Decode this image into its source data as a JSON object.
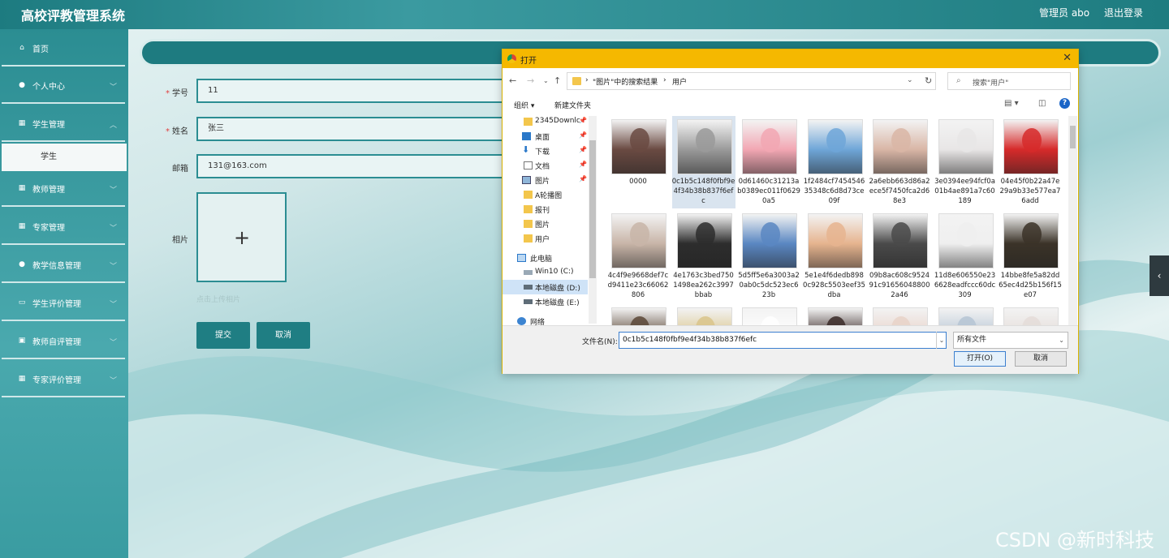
{
  "app": {
    "title": "高校评教管理系统",
    "user_label": "管理员 abo",
    "logout": "退出登录"
  },
  "sidebar": {
    "items": [
      {
        "label": "首页",
        "icon": "home-icon"
      },
      {
        "label": "个人中心",
        "icon": "user-icon"
      },
      {
        "label": "学生管理",
        "icon": "grid-icon"
      },
      {
        "label": "教师管理",
        "icon": "grid-icon"
      },
      {
        "label": "专家管理",
        "icon": "grid-icon"
      },
      {
        "label": "教学信息管理",
        "icon": "user-icon"
      },
      {
        "label": "学生评价管理",
        "icon": "id-card-icon"
      },
      {
        "label": "教师自评管理",
        "icon": "case-icon"
      },
      {
        "label": "专家评价管理",
        "icon": "grid-icon"
      }
    ],
    "sub_item": "学生"
  },
  "form": {
    "fields": [
      {
        "label": "学号",
        "required": "*",
        "value": "11"
      },
      {
        "label": "姓名",
        "required": "*",
        "value": "张三"
      },
      {
        "label": "邮箱",
        "required": "",
        "value": "131@163.com"
      }
    ],
    "photo_label": "相片",
    "upload_hint": "点击上传相片",
    "submit": "提交",
    "cancel": "取消"
  },
  "dialog": {
    "title": "打开",
    "breadcrumb": [
      "\"图片\"中的搜索结果",
      "用户"
    ],
    "search_placeholder": "搜索\"用户\"",
    "toolbar": {
      "organize": "组织 ▾",
      "new_folder": "新建文件夹"
    },
    "tree": [
      {
        "label": "2345Downlc",
        "pinned": true,
        "icon": "folder"
      },
      {
        "label": "桌面",
        "pinned": true,
        "icon": "desktop"
      },
      {
        "label": "下载",
        "pinned": true,
        "icon": "download"
      },
      {
        "label": "文档",
        "pinned": true,
        "icon": "document"
      },
      {
        "label": "图片",
        "pinned": true,
        "icon": "picture"
      },
      {
        "label": "A轮播图",
        "pinned": false,
        "icon": "folder"
      },
      {
        "label": "报刊",
        "pinned": false,
        "icon": "folder"
      },
      {
        "label": "图片",
        "pinned": false,
        "icon": "folder"
      },
      {
        "label": "用户",
        "pinned": false,
        "icon": "folder"
      },
      {
        "label": "此电脑",
        "pinned": false,
        "icon": "computer"
      },
      {
        "label": "Win10 (C:)",
        "pinned": false,
        "icon": "drive"
      },
      {
        "label": "本地磁盘 (D:)",
        "pinned": false,
        "icon": "drive"
      },
      {
        "label": "本地磁盘 (E:)",
        "pinned": false,
        "icon": "drive"
      },
      {
        "label": "网络",
        "pinned": false,
        "icon": "network"
      }
    ],
    "files": [
      {
        "name": "0000",
        "color": "#6a4a42"
      },
      {
        "name": "0c1b5c148f0fbf9e4f34b38b837f6efc",
        "color": "#9a9a9a"
      },
      {
        "name": "0d61460c31213ab0389ec011f06290a5",
        "color": "#f2a7b3"
      },
      {
        "name": "1f2484cf745454635348c6d8d73ce09f",
        "color": "#6fa6d8"
      },
      {
        "name": "2a6ebb663d86a2ece5f7450fca2d68e3",
        "color": "#d9b6a6"
      },
      {
        "name": "3e0394ee94fcf0a01b4ae891a7c60189",
        "color": "#e8e6e6"
      },
      {
        "name": "04e45f0b22a47e29a9b33e577ea76add",
        "color": "#d62a2a"
      },
      {
        "name": "4c4f9e9668def7cd9411e23c66062806",
        "color": "#c8b5a8"
      },
      {
        "name": "4e1763c3bed7501498ea262c3997bbab",
        "color": "#2d2d2d"
      },
      {
        "name": "5d5ff5e6a3003a20ab0c5dc523ec623b",
        "color": "#5a87c2"
      },
      {
        "name": "5e1e4f6dedb8980c928c5503eef35dba",
        "color": "#e6b48f"
      },
      {
        "name": "09b8ac608c952491c916560488002a46",
        "color": "#4a4a4a"
      },
      {
        "name": "11d8e606550e236628eadfccc60dc309",
        "color": "#efefef"
      },
      {
        "name": "14bbe8fe5a82dd65ec4d25b156f15e07",
        "color": "#3b3328"
      },
      {
        "name": "",
        "color": "#5a4636"
      },
      {
        "name": "",
        "color": "#d9c48a"
      },
      {
        "name": "",
        "color": "#ffffff"
      },
      {
        "name": "",
        "color": "#3a2a28"
      },
      {
        "name": "",
        "color": "#e8d2c8"
      },
      {
        "name": "",
        "color": "#b5c4d4"
      },
      {
        "name": "",
        "color": "#e4dcd8"
      }
    ],
    "filename_label": "文件名(N):",
    "filename_value": "0c1b5c148f0fbf9e4f34b38b837f6efc",
    "filetype": "所有文件",
    "open": "打开(O)",
    "cancel": "取消"
  },
  "watermark": "CSDN @新时科技"
}
